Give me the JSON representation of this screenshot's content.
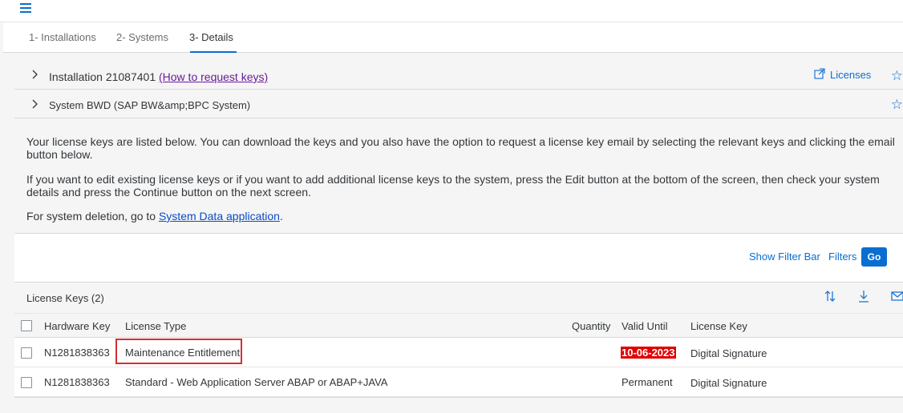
{
  "tabs": [
    "1- Installations",
    "2- Systems",
    "3- Details"
  ],
  "installation": {
    "label": "Installation 21087401",
    "link": "(How to request keys)",
    "licenses_link": "Licenses"
  },
  "system": {
    "label": "System BWD (SAP BW&amp;BPC System)"
  },
  "info": {
    "p1": "Your license keys are listed below. You can download the keys and you also have the option to request a license key email by selecting the relevant keys and clicking the email button below.",
    "p2": "If you want to edit existing license keys or if you want to add additional license keys to the system, press the Edit button at the bottom of the screen, then check your system details and press the Continue button on the next screen.",
    "p3_prefix": "For system deletion, go to ",
    "p3_link": "System Data application",
    "p3_suffix": "."
  },
  "filterbar": {
    "show_filter": "Show Filter Bar",
    "filters": "Filters",
    "go": "Go"
  },
  "table": {
    "title": "License Keys (2)",
    "columns": [
      "Hardware Key",
      "License Type",
      "Quantity",
      "Valid Until",
      "License Key"
    ],
    "rows": [
      {
        "hardware_key": "N1281838363",
        "license_type": "Maintenance Entitlement",
        "quantity": "",
        "valid_until": "10-06-2023",
        "license_key": "Digital Signature"
      },
      {
        "hardware_key": "N1281838363",
        "license_type": "Standard - Web Application Server ABAP or ABAP+JAVA",
        "quantity": "",
        "valid_until": "Permanent",
        "license_key": "Digital Signature"
      }
    ]
  },
  "icons": {
    "menu": "hamburger-icon",
    "expand": "chevron-right-icon",
    "favorite": "star-icon",
    "external": "external-link-icon",
    "sort": "sort-icon",
    "download": "download-icon",
    "email": "email-icon"
  },
  "colors": {
    "accent": "#0a6ed1",
    "highlight_date": "#e00000",
    "annotation_box": "#d43030",
    "visited_link": "#6a1b9a"
  }
}
